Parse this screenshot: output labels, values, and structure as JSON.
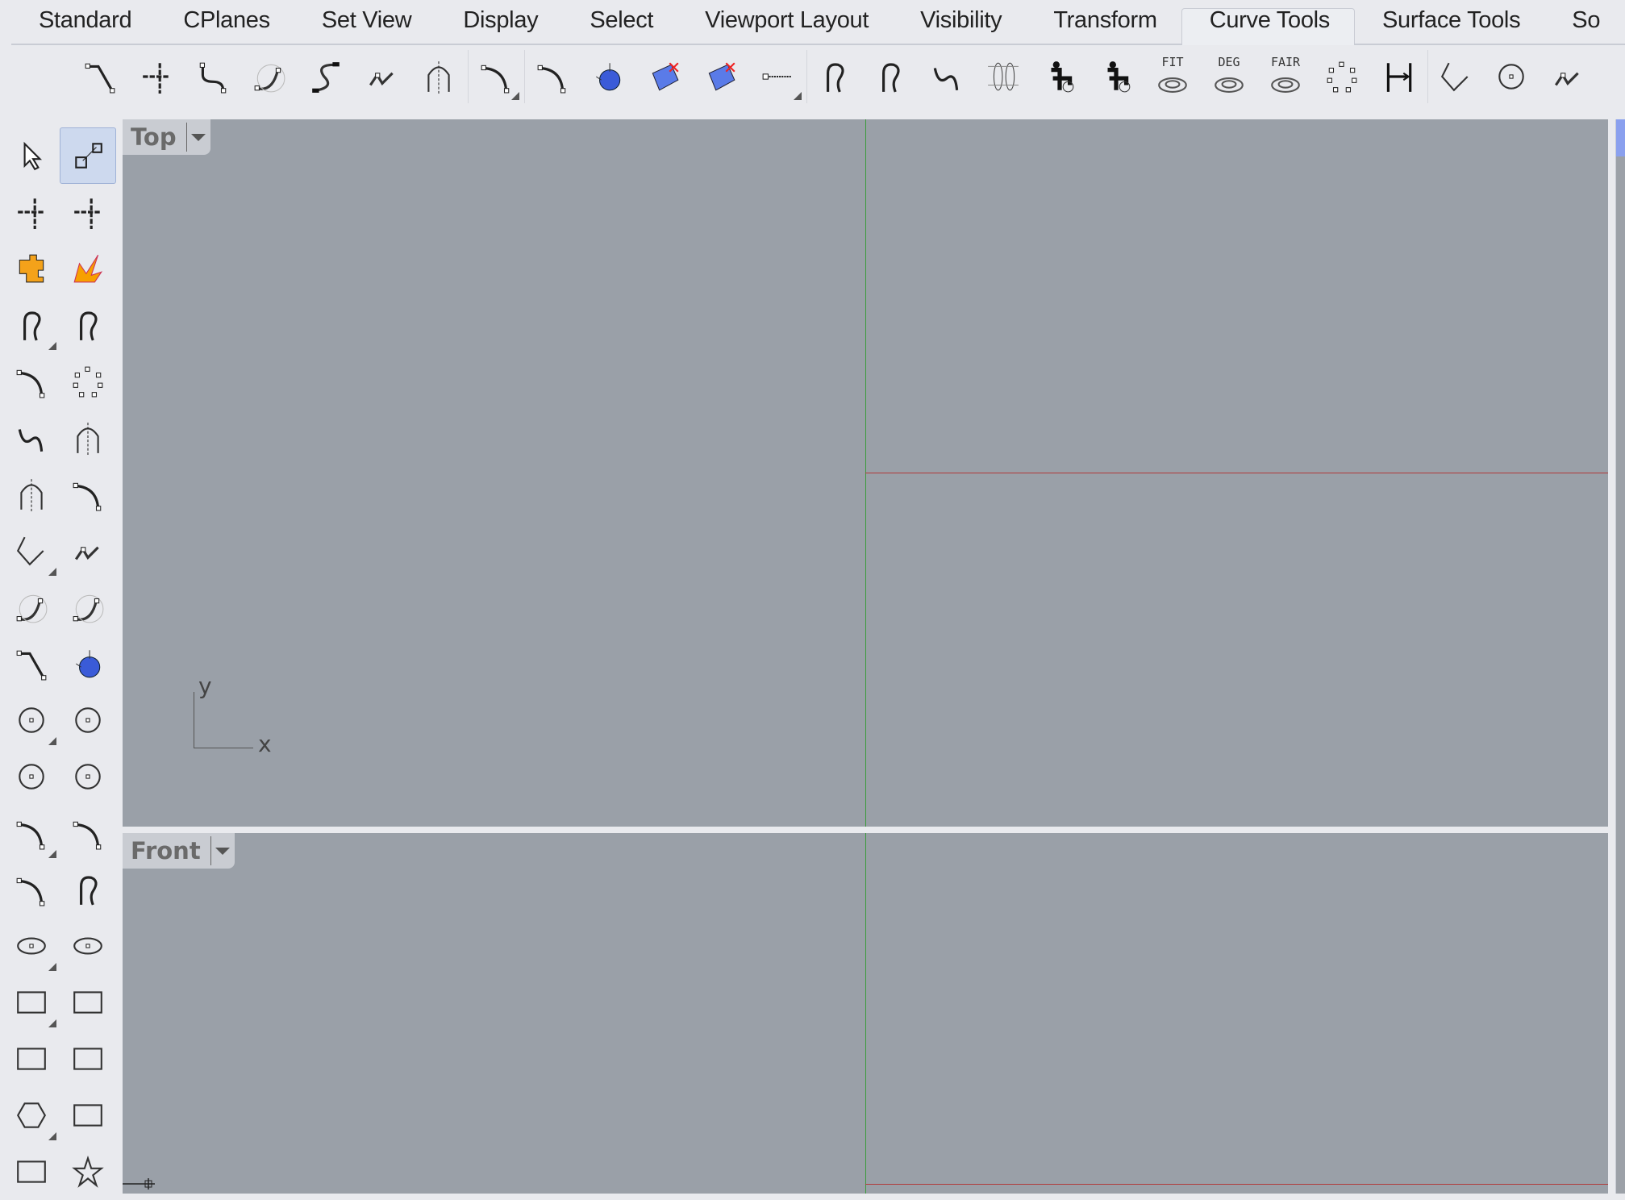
{
  "tabs": [
    {
      "label": "Standard"
    },
    {
      "label": "CPlanes"
    },
    {
      "label": "Set View"
    },
    {
      "label": "Display"
    },
    {
      "label": "Select"
    },
    {
      "label": "Viewport Layout"
    },
    {
      "label": "Visibility"
    },
    {
      "label": "Transform"
    },
    {
      "label": "Curve Tools",
      "active": true
    },
    {
      "label": "Surface Tools"
    },
    {
      "label": "So"
    }
  ],
  "toolbar": [
    {
      "icon": "fillet-corners-icon",
      "shape": "corner"
    },
    {
      "icon": "extend-curve-icon",
      "shape": "cross"
    },
    {
      "icon": "blend-curves-icon",
      "shape": "blend"
    },
    {
      "icon": "adjustable-blend-icon",
      "shape": "curve"
    },
    {
      "icon": "connect-curves-icon",
      "shape": "s"
    },
    {
      "icon": "offset-polyline-icon",
      "shape": "zig"
    },
    {
      "icon": "symmetry-icon",
      "shape": "arch"
    },
    {
      "icon": "offset-curve-icon",
      "shape": "arc",
      "flyout": true,
      "sep": true
    },
    {
      "icon": "rebuild-curve-icon",
      "shape": "arc",
      "sep": true
    },
    {
      "icon": "pull-to-surface-icon",
      "shape": "sphere"
    },
    {
      "icon": "delete-control-point-icon",
      "shape": "surface"
    },
    {
      "icon": "project-curve-icon",
      "shape": "surface"
    },
    {
      "icon": "extend-by-line-icon",
      "shape": "dotline",
      "flyout": true
    },
    {
      "icon": "change-seam-icon",
      "shape": "loop",
      "sep": true
    },
    {
      "icon": "closed-curve-icon",
      "shape": "loop"
    },
    {
      "icon": "curve-through-polyline-icon",
      "shape": "wave"
    },
    {
      "icon": "cylinder-section-icon",
      "shape": "cyl"
    },
    {
      "icon": "make-periodic-icon",
      "shape": "person"
    },
    {
      "icon": "make-non-periodic-icon",
      "shape": "person"
    },
    {
      "icon": "fit-curve-icon",
      "shape": "spiral",
      "label": "FIT"
    },
    {
      "icon": "change-degree-icon",
      "shape": "spiral",
      "label": "DEG"
    },
    {
      "icon": "fair-curve-icon",
      "shape": "spiral",
      "label": "FAIR"
    },
    {
      "icon": "points-circle-icon",
      "shape": "dots"
    },
    {
      "icon": "match-curve-icon",
      "shape": "match"
    },
    {
      "icon": "polyline-icon",
      "shape": "poly",
      "sep": true
    },
    {
      "icon": "circle-points-icon",
      "shape": "circle"
    },
    {
      "icon": "control-polygon-icon",
      "shape": "zig"
    }
  ],
  "left_toolbar": [
    {
      "icon": "select-arrow-icon",
      "shape": "arrow"
    },
    {
      "icon": "points-on-icon",
      "shape": "scale",
      "active": true
    },
    {
      "icon": "cplane-icon",
      "shape": "cross"
    },
    {
      "icon": "gumball-icon",
      "shape": "cross"
    },
    {
      "icon": "puzzle-icon",
      "shape": "puzzle"
    },
    {
      "icon": "flamingo-icon",
      "shape": "flame"
    },
    {
      "icon": "curve-points-icon",
      "shape": "loop",
      "flyout": true
    },
    {
      "icon": "closed-curve-points-icon",
      "shape": "loop"
    },
    {
      "icon": "interpolate-curve-icon",
      "shape": "arc"
    },
    {
      "icon": "control-point-curve-icon",
      "shape": "dots"
    },
    {
      "icon": "sketch-curve-icon",
      "shape": "wave"
    },
    {
      "icon": "parabola-icon",
      "shape": "arch"
    },
    {
      "icon": "hyperbola-icon",
      "shape": "arch"
    },
    {
      "icon": "conic-icon",
      "shape": "arc"
    },
    {
      "icon": "polyline-icon",
      "shape": "poly",
      "flyout": true
    },
    {
      "icon": "line-icon",
      "shape": "zig"
    },
    {
      "icon": "line-tangent-icon",
      "shape": "curve"
    },
    {
      "icon": "line-perpendicular-icon",
      "shape": "curve"
    },
    {
      "icon": "line-normal-icon",
      "shape": "corner"
    },
    {
      "icon": "sphere-line-icon",
      "shape": "sphere"
    },
    {
      "icon": "circle-center-icon",
      "shape": "circle",
      "flyout": true
    },
    {
      "icon": "circle-diameter-icon",
      "shape": "circle"
    },
    {
      "icon": "circle-3pt-icon",
      "shape": "circle"
    },
    {
      "icon": "circle-tangent-icon",
      "shape": "circle"
    },
    {
      "icon": "arc-center-icon",
      "shape": "arc",
      "flyout": true
    },
    {
      "icon": "arc-3pt-icon",
      "shape": "arc"
    },
    {
      "icon": "arc-tangent-icon",
      "shape": "arc"
    },
    {
      "icon": "arc-extend-icon",
      "shape": "loop"
    },
    {
      "icon": "ellipse-center-icon",
      "shape": "ellipse",
      "flyout": true
    },
    {
      "icon": "ellipse-diameter-icon",
      "shape": "ellipse"
    },
    {
      "icon": "rectangle-corner-icon",
      "shape": "rect",
      "flyout": true
    },
    {
      "icon": "rectangle-center-icon",
      "shape": "rect"
    },
    {
      "icon": "rounded-rectangle-icon",
      "shape": "rect"
    },
    {
      "icon": "rectangle-3pt-icon",
      "shape": "rect"
    },
    {
      "icon": "polygon-center-icon",
      "shape": "hex",
      "flyout": true
    },
    {
      "icon": "polygon-edge-icon",
      "shape": "rect"
    },
    {
      "icon": "square-icon",
      "shape": "rect"
    },
    {
      "icon": "star-icon",
      "shape": "star"
    }
  ],
  "viewports": {
    "top": {
      "label": "Top",
      "axis_x": "x",
      "axis_y": "y"
    },
    "front": {
      "label": "Front"
    }
  },
  "colors": {
    "viewport_bg": "#9aa0a8",
    "x_axis": "#b03a3a",
    "y_axis": "#3c9a3c",
    "accent": "#8aa0ee"
  }
}
